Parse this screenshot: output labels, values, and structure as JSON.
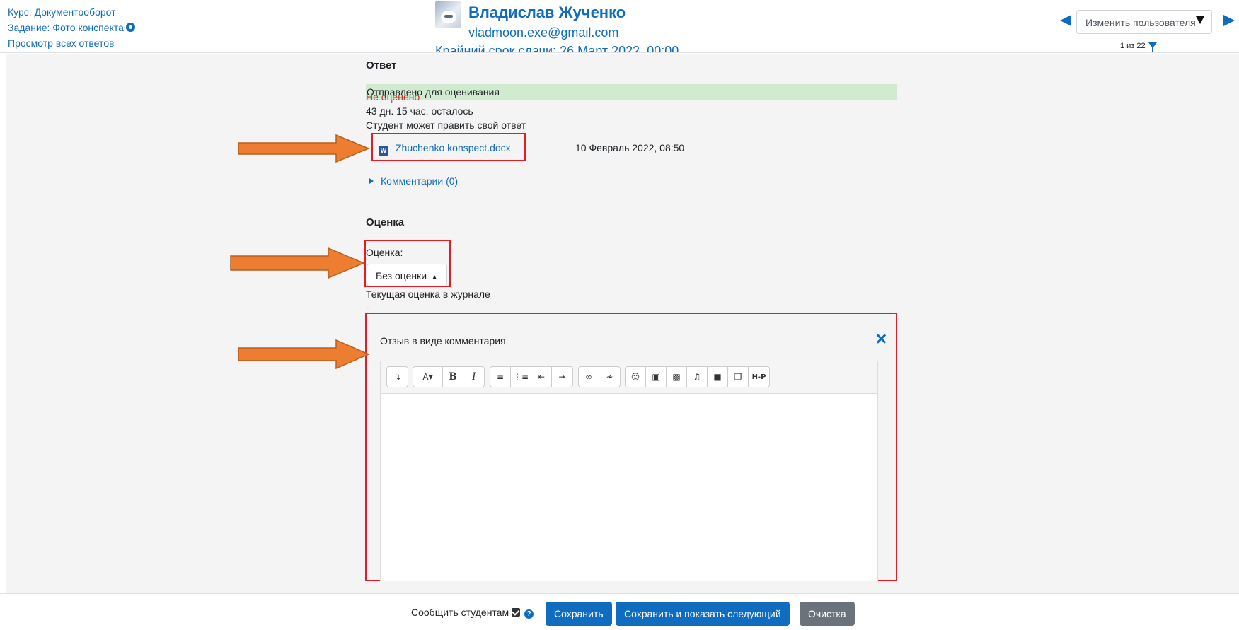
{
  "header": {
    "course_link": "Курс: Документооборот",
    "assignment_link": "Задание: Фото конспекта",
    "view_all_link": "Просмотр всех ответов",
    "user_name": "Владислав Жученко",
    "user_email": "vladmoon.exe@gmail.com",
    "deadline": "Крайний срок сдачи: 26 Март 2022, 00:00",
    "change_user_label": "Изменить пользователя",
    "counter": "1 из 22"
  },
  "submission": {
    "heading": "Ответ",
    "status": "Отправлено для оценивания",
    "grading_status": "Не оценено",
    "time_remaining": "43 дн. 15 час. осталось",
    "can_edit": "Студент может править свой ответ",
    "file_name": "Zhuchenko konspect.docx",
    "file_date": "10 Февраль 2022, 08:50",
    "comments_label": "Комментарии (0)"
  },
  "grade": {
    "heading": "Оценка",
    "field_label": "Оценка:",
    "selected_value": "Без оценки",
    "current_grade_label": "Текущая оценка в журнале",
    "current_grade_value": "-"
  },
  "feedback": {
    "label": "Отзыв в виде комментария",
    "toolbar": {
      "collapse": "↴",
      "font": "A▾",
      "bold": "B",
      "italic": "I",
      "h5p": "H-P"
    }
  },
  "footer": {
    "notify_label": "Сообщить студентам",
    "save_label": "Сохранить",
    "save_next_label": "Сохранить и показать следующий",
    "reset_label": "Очистка"
  },
  "colors": {
    "accent": "#0f6cbf",
    "highlight": "#e51c23",
    "arrow": "#ed7d31",
    "status_bg": "#d1ebd0"
  }
}
